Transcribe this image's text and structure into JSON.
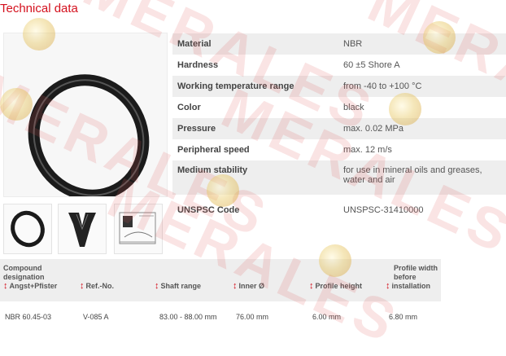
{
  "page_title": "Technical data",
  "specs": [
    {
      "label": "Material",
      "value": "NBR"
    },
    {
      "label": "Hardness",
      "value": "60 ±5 Shore A"
    },
    {
      "label": "Working temperature range",
      "value": "from -40 to +100 °C"
    },
    {
      "label": "Color",
      "value": "black"
    },
    {
      "label": "Pressure",
      "value": "max. 0.02 MPa"
    },
    {
      "label": "Peripheral speed",
      "value": "max. 12 m/s"
    },
    {
      "label": "Medium stability",
      "value": "for use in mineral oils and greases, water and air"
    },
    {
      "label": "UNSPSC Code",
      "value": "UNSPSC-31410000"
    }
  ],
  "table": {
    "headers": [
      {
        "line1": "Compound",
        "line2": "designation",
        "line3": "Angst+Pfister"
      },
      {
        "line3": "Ref.-No."
      },
      {
        "line3": "Shaft range"
      },
      {
        "line3": "Inner Ø"
      },
      {
        "line3": "Profile height"
      },
      {
        "line1": "Profile width",
        "line2": "before",
        "line3": "installation"
      }
    ],
    "rows": [
      [
        "NBR 60.45-03",
        "V-085 A",
        "83.00 - 88.00 mm",
        "76.00 mm",
        "6.00 mm",
        "6.80 mm"
      ]
    ]
  },
  "watermark_text": "MERALES",
  "colors": {
    "accent": "#d4111e",
    "watermark": "#e25757"
  }
}
